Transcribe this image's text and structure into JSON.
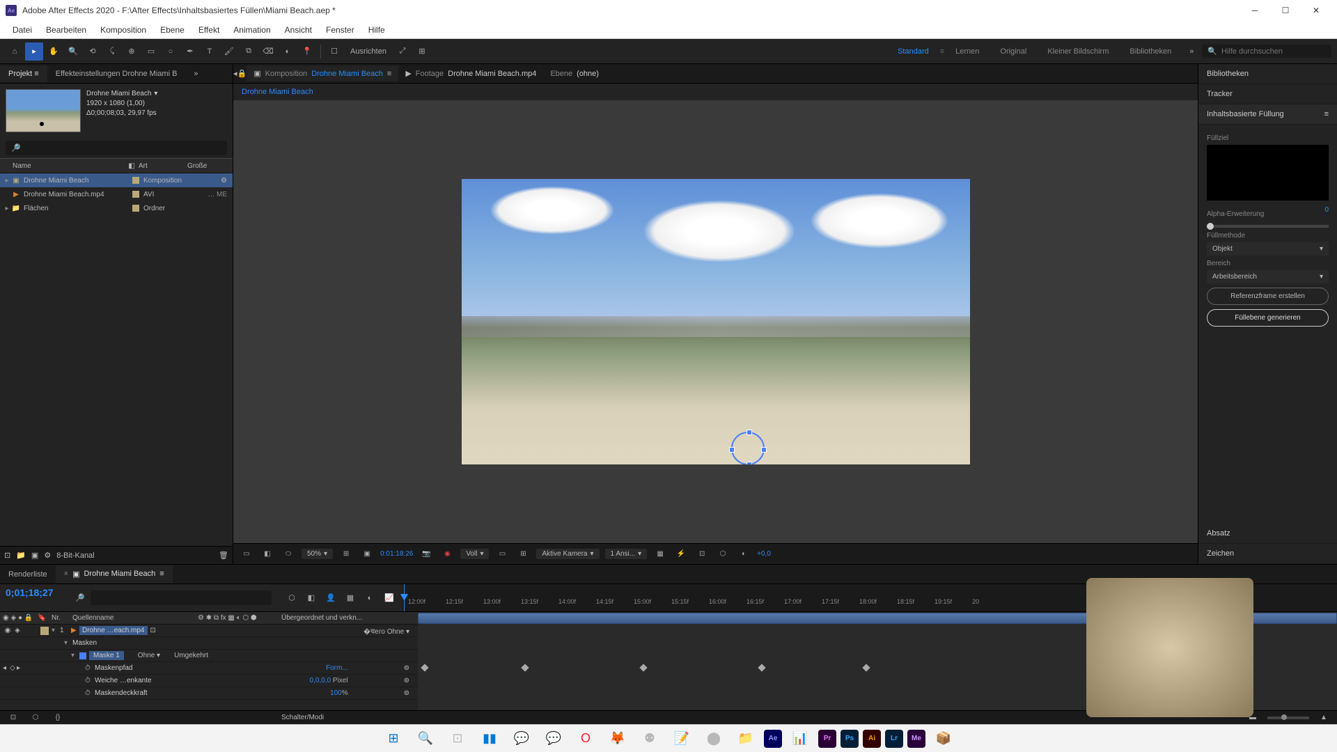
{
  "title": "Adobe After Effects 2020 - F:\\After Effects\\Inhaltsbasiertes Füllen\\Miami Beach.aep *",
  "menu": [
    "Datei",
    "Bearbeiten",
    "Komposition",
    "Ebene",
    "Effekt",
    "Animation",
    "Ansicht",
    "Fenster",
    "Hilfe"
  ],
  "toolbar": {
    "align_label": "Ausrichten",
    "workspaces": [
      "Standard",
      "Lernen",
      "Original",
      "Kleiner Bildschirm",
      "Bibliotheken"
    ],
    "active_ws": "Standard",
    "search_placeholder": "Hilfe durchsuchen"
  },
  "project_panel": {
    "tab": "Projekt",
    "effects_tab": "Effekteinstellungen Drohne Miami B",
    "selected": {
      "name": "Drohne Miami Beach",
      "res": "1920 x 1080 (1,00)",
      "dur": "Δ0;00;08;03, 29,97 fps"
    },
    "cols": {
      "name": "Name",
      "type": "Art",
      "size": "Große"
    },
    "items": [
      {
        "name": "Drohne Miami Beach",
        "type": "Komposition",
        "color": "#b8a878",
        "selected": true,
        "icon": "comp"
      },
      {
        "name": "Drohne Miami Beach.mp4",
        "type": "AVI",
        "size": "… ME",
        "color": "#b8a878",
        "icon": "video"
      },
      {
        "name": "Flächen",
        "type": "Ordner",
        "color": "#b8a878",
        "icon": "folder"
      }
    ],
    "bit_label": "8-Bit-Kanal"
  },
  "comp": {
    "tabs": [
      {
        "label": "Komposition",
        "value": "Drohne Miami Beach",
        "active": true
      },
      {
        "label": "Footage",
        "value": "Drohne Miami Beach.mp4"
      },
      {
        "label": "Ebene",
        "value": "(ohne)"
      }
    ],
    "breadcrumb": "Drohne Miami Beach",
    "zoom": "50%",
    "tc": "0:01:18:26",
    "res": "Voll",
    "camera": "Aktive Kamera",
    "views": "1 Ansi...",
    "exp": "+0,0"
  },
  "right": {
    "tabs": [
      "Bibliotheken",
      "Tracker"
    ],
    "fill_title": "Inhaltsbasierte Füllung",
    "fill_target": "Füllziel",
    "alpha": "Alpha-Erweiterung",
    "alpha_val": "0",
    "method": "Füllmethode",
    "method_val": "Objekt",
    "range": "Bereich",
    "range_val": "Arbeitsbereich",
    "ref_btn": "Referenzframe erstellen",
    "gen_btn": "Füllebene generieren",
    "absatz": "Absatz",
    "zeichen": "Zeichen"
  },
  "timeline": {
    "render_tab": "Renderliste",
    "comp_tab": "Drohne Miami Beach",
    "tc": "0;01;18;27",
    "fps": "",
    "cols": {
      "nr": "Nr.",
      "src": "Quellenname",
      "parent": "Übergeordnet und verkn..."
    },
    "layer": {
      "nr": "1",
      "name": "Drohne …each.mp4",
      "parent": "Ohne"
    },
    "masks": "Masken",
    "mask_name": "Maske 1",
    "mask_mode": "Ohne",
    "inverted": "Umgekehrt",
    "props": [
      {
        "name": "Maskenpfad",
        "val": "Form..."
      },
      {
        "name": "Weiche …enkante",
        "val": "0,0,0,0",
        "unit": "Pixel"
      },
      {
        "name": "Maskendeckkraft",
        "val": "100",
        "unit": "%"
      }
    ],
    "ticks": [
      "12:00f",
      "12:15f",
      "13:00f",
      "13:15f",
      "14:00f",
      "14:15f",
      "15:00f",
      "15:15f",
      "16:00f",
      "16:15f",
      "17:00f",
      "17:15f",
      "18:00f",
      "18:15f",
      "19:15f",
      "20"
    ],
    "switches": "Schalter/Modi"
  }
}
